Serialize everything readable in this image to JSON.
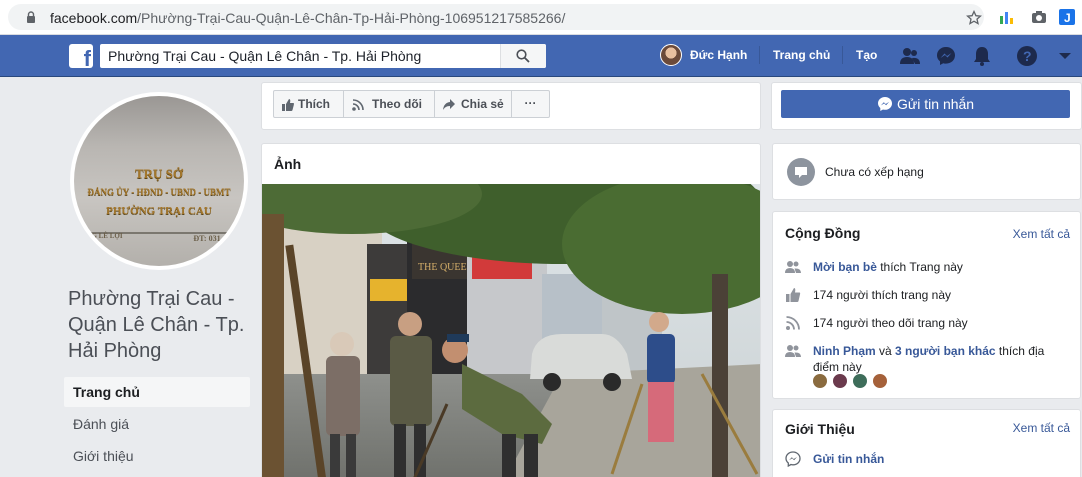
{
  "browser": {
    "url_host": "facebook.com",
    "url_path": "/Phường-Trại-Cau-Quận-Lê-Chân-Tp-Hải-Phòng-106951217585266/"
  },
  "topbar": {
    "search_value": "Phường Trại Cau - Quận Lê Chân - Tp. Hải Phòng",
    "user_name": "Đức Hạnh",
    "home_label": "Trang chủ",
    "create_label": "Tạo",
    "brand_color": "#4267b2"
  },
  "page": {
    "title": "Phường Trại Cau - Quận Lê Chân - Tp. Hải Phòng",
    "profile_sign": {
      "line1": "TRỤ SỞ",
      "line2": "ĐẢNG ỦY - HĐND - UBND - UBMT",
      "line3": "PHƯỜNG TRẠI CAU",
      "line4": "G LÊ LỢI",
      "line5": "ĐT: 031"
    }
  },
  "leftnav": {
    "items": [
      {
        "label": "Trang chủ",
        "active": true
      },
      {
        "label": "Đánh giá",
        "active": false
      },
      {
        "label": "Giới thiệu",
        "active": false
      }
    ]
  },
  "actions": {
    "like": "Thích",
    "follow": "Theo dõi",
    "share": "Chia sẻ",
    "more": "···",
    "send_message": "Gửi tin nhắn"
  },
  "photos": {
    "header": "Ảnh"
  },
  "rating": {
    "text": "Chưa có xếp hạng"
  },
  "community": {
    "title": "Cộng Đồng",
    "see_all": "Xem tất cả",
    "friends_invite_bold": "Mời bạn bè",
    "friends_invite_rest": " thích Trang này",
    "likes": "174 người thích trang này",
    "follows": "174 người theo dõi trang này",
    "visited_name": "Ninh Phạm",
    "visited_and": " và ",
    "visited_others": "3 người bạn khác",
    "visited_rest": " thích địa điểm này"
  },
  "about": {
    "title": "Giới Thiệu",
    "see_all": "Xem tất cả",
    "send_message": "Gửi tin nhắn"
  }
}
